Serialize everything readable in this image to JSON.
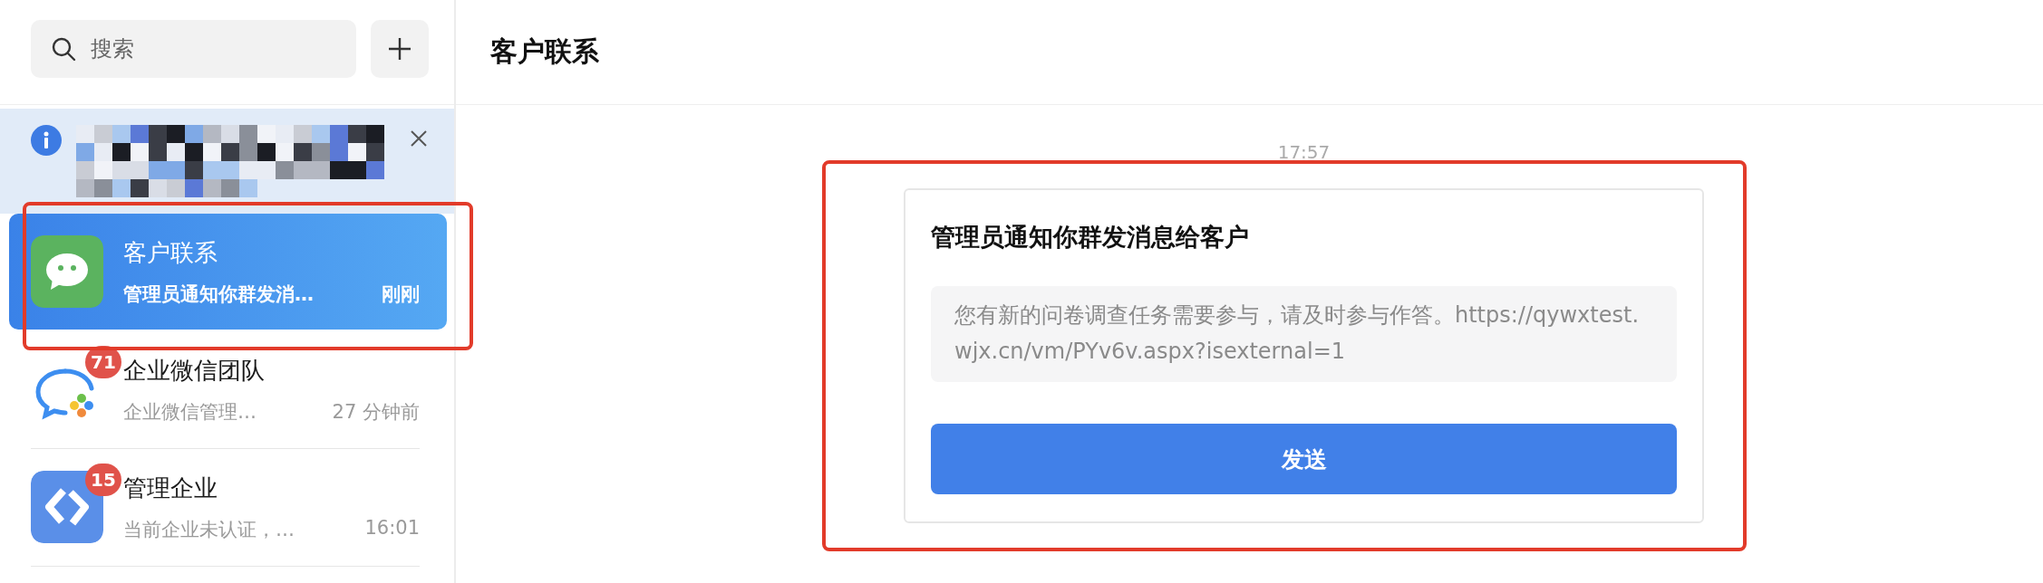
{
  "search": {
    "placeholder": "搜索"
  },
  "header": {
    "title": "客户联系"
  },
  "notice": {
    "kind": "redacted"
  },
  "conversations": [
    {
      "kind": "chat-green",
      "name": "客户联系",
      "preview": "管理员通知你群发消…",
      "time": "刚刚",
      "selected": true
    },
    {
      "kind": "team",
      "badge": "71",
      "name": "企业微信团队",
      "preview": "企业微信管理…",
      "time": "27 分钟前",
      "selected": false
    },
    {
      "kind": "manage",
      "badge": "15",
      "name": "管理企业",
      "preview": "当前企业未认证，…",
      "time": "16:01",
      "selected": false
    }
  ],
  "messages": [
    {
      "time": "17:57",
      "title": "管理员通知你群发消息给客户",
      "body": "您有新的问卷调查任务需要参与，请及时参与作答。https://qywxtest.wjx.cn/vm/PYv6v.aspx?isexternal=1",
      "button": "发送"
    }
  ]
}
